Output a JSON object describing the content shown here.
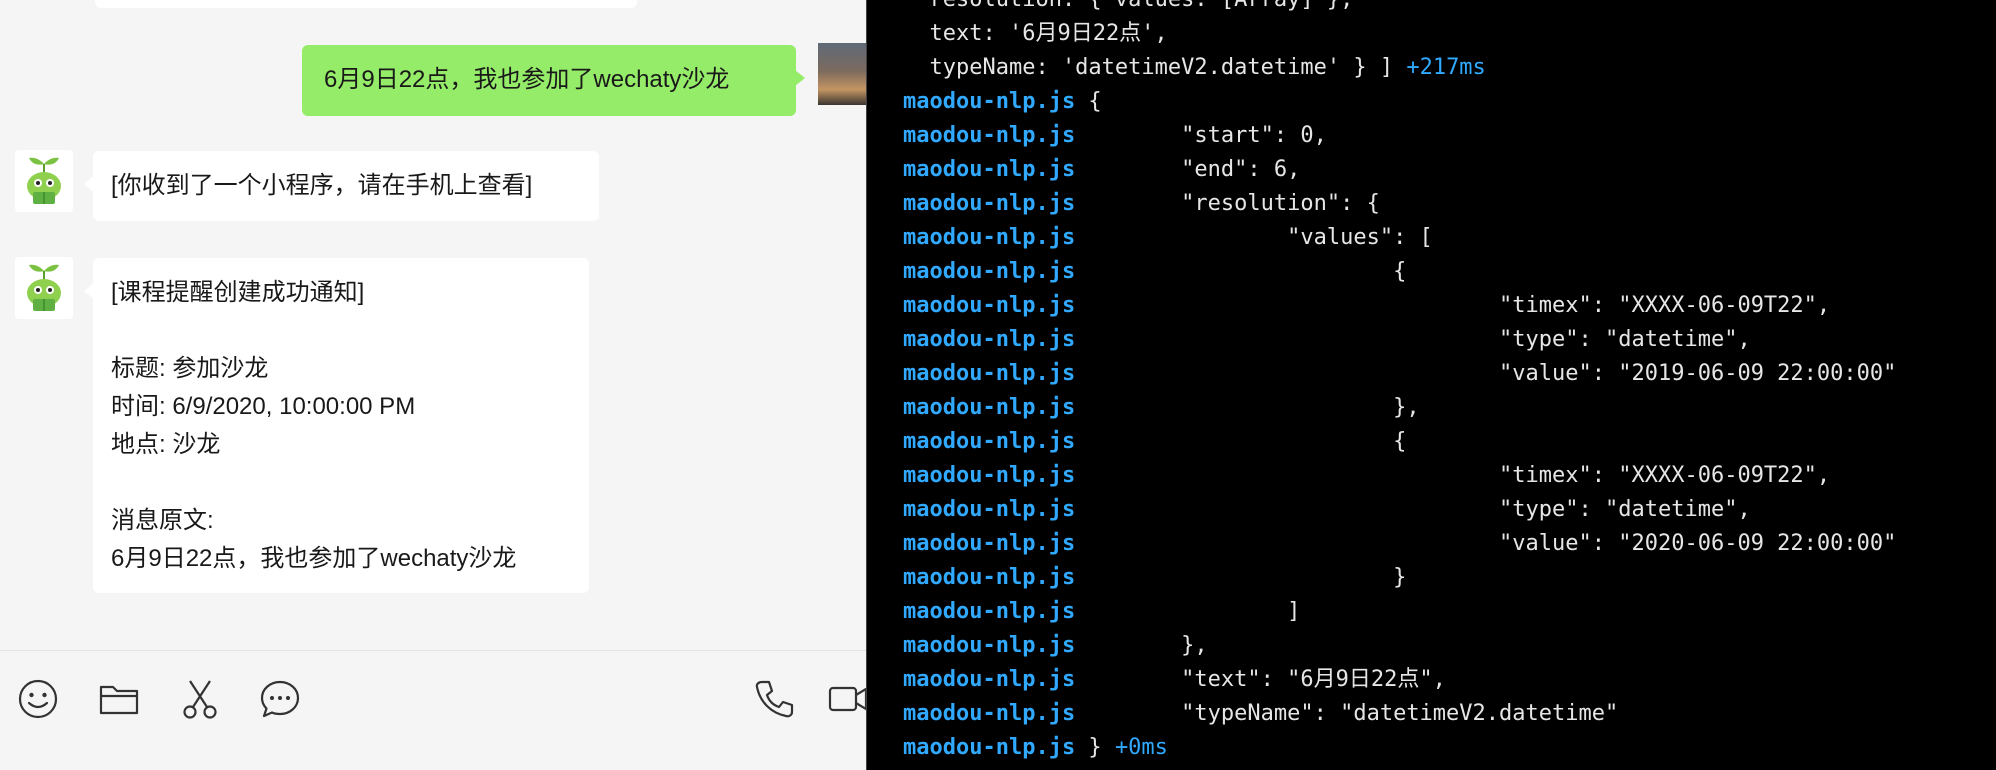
{
  "chat": {
    "outgoing_message": "6月9日22点，我也参加了wechaty沙龙",
    "incoming_message_1": "[你收到了一个小程序，请在手机上查看]",
    "notice": {
      "header": "[课程提醒创建成功通知]",
      "title_line": "标题: 参加沙龙",
      "time_line": "时间: 6/9/2020, 10:00:00 PM",
      "place_line": "地点: 沙龙",
      "original_label": "消息原文:",
      "original_text": "6月9日22点，我也参加了wechaty沙龙"
    },
    "toolbar": {
      "emoji_icon": "emoji-icon",
      "folder_icon": "folder-icon",
      "scissors_icon": "scissors-icon",
      "chat_icon": "chat-bubble-icon",
      "phone_icon": "phone-icon",
      "video_icon": "video-icon"
    }
  },
  "terminal": {
    "prefix": "maodou-nlp.js",
    "lines": [
      {
        "prefix": "",
        "text": "  resolution: { values: [Array] },",
        "time": ""
      },
      {
        "prefix": "",
        "text": "  text: '6月9日22点',",
        "time": ""
      },
      {
        "prefix": "",
        "text": "  typeName: 'datetimeV2.datetime' } ] ",
        "time": "+217ms"
      },
      {
        "prefix": "maodou-nlp.js",
        "text": " {",
        "time": ""
      },
      {
        "prefix": "maodou-nlp.js",
        "text": "        \"start\": 0,",
        "time": ""
      },
      {
        "prefix": "maodou-nlp.js",
        "text": "        \"end\": 6,",
        "time": ""
      },
      {
        "prefix": "maodou-nlp.js",
        "text": "        \"resolution\": {",
        "time": ""
      },
      {
        "prefix": "maodou-nlp.js",
        "text": "                \"values\": [",
        "time": ""
      },
      {
        "prefix": "maodou-nlp.js",
        "text": "                        {",
        "time": ""
      },
      {
        "prefix": "maodou-nlp.js",
        "text": "                                \"timex\": \"XXXX-06-09T22\",",
        "time": ""
      },
      {
        "prefix": "maodou-nlp.js",
        "text": "                                \"type\": \"datetime\",",
        "time": ""
      },
      {
        "prefix": "maodou-nlp.js",
        "text": "                                \"value\": \"2019-06-09 22:00:00\"",
        "time": ""
      },
      {
        "prefix": "maodou-nlp.js",
        "text": "                        },",
        "time": ""
      },
      {
        "prefix": "maodou-nlp.js",
        "text": "                        {",
        "time": ""
      },
      {
        "prefix": "maodou-nlp.js",
        "text": "                                \"timex\": \"XXXX-06-09T22\",",
        "time": ""
      },
      {
        "prefix": "maodou-nlp.js",
        "text": "                                \"type\": \"datetime\",",
        "time": ""
      },
      {
        "prefix": "maodou-nlp.js",
        "text": "                                \"value\": \"2020-06-09 22:00:00\"",
        "time": ""
      },
      {
        "prefix": "maodou-nlp.js",
        "text": "                        }",
        "time": ""
      },
      {
        "prefix": "maodou-nlp.js",
        "text": "                ]",
        "time": ""
      },
      {
        "prefix": "maodou-nlp.js",
        "text": "        },",
        "time": ""
      },
      {
        "prefix": "maodou-nlp.js",
        "text": "        \"text\": \"6月9日22点\",",
        "time": ""
      },
      {
        "prefix": "maodou-nlp.js",
        "text": "        \"typeName\": \"datetimeV2.datetime\"",
        "time": ""
      },
      {
        "prefix": "maodou-nlp.js",
        "text": " } ",
        "time": "+0ms"
      }
    ]
  },
  "colors": {
    "outgoing_bubble": "#95ec69",
    "incoming_bubble": "#ffffff",
    "chat_background": "#f5f5f5",
    "terminal_background": "#000000",
    "terminal_prefix": "#30a9ff",
    "terminal_text": "#e6e6e6"
  }
}
